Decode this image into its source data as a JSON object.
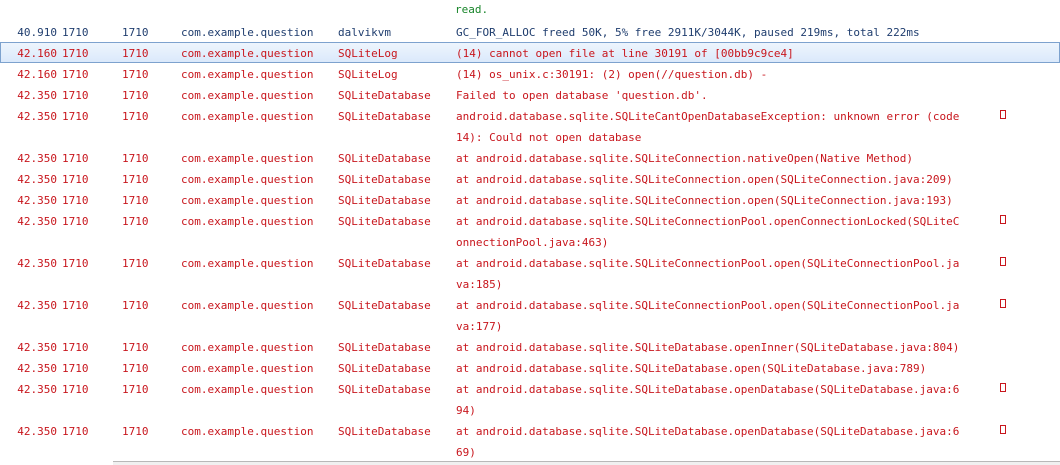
{
  "log": {
    "header_fragment": "read.",
    "rows": [
      {
        "time": "40.910",
        "pid": "1710",
        "tid": "1710",
        "app": "com.example.question",
        "tag": "dalvikvm",
        "text": "GC_FOR_ALLOC freed 50K, 5% free 2911K/3044K, paused 219ms, total 222ms",
        "text2": "",
        "level": "debug",
        "selected": false
      },
      {
        "time": "42.160",
        "pid": "1710",
        "tid": "1710",
        "app": "com.example.question",
        "tag": "SQLiteLog",
        "text": "(14) cannot open file at line 30191 of [00bb9c9ce4]",
        "text2": "",
        "level": "error",
        "selected": true
      },
      {
        "time": "42.160",
        "pid": "1710",
        "tid": "1710",
        "app": "com.example.question",
        "tag": "SQLiteLog",
        "text": "(14) os_unix.c:30191: (2) open(//question.db) -",
        "text2": "",
        "level": "error",
        "selected": false
      },
      {
        "time": "42.350",
        "pid": "1710",
        "tid": "1710",
        "app": "com.example.question",
        "tag": "SQLiteDatabase",
        "text": "Failed to open database 'question.db'.",
        "text2": "",
        "level": "error",
        "selected": false
      },
      {
        "time": "42.350",
        "pid": "1710",
        "tid": "1710",
        "app": "com.example.question",
        "tag": "SQLiteDatabase",
        "text": "android.database.sqlite.SQLiteCantOpenDatabaseException: unknown error (code",
        "text2": "14): Could not open database",
        "level": "error",
        "selected": false
      },
      {
        "time": "42.350",
        "pid": "1710",
        "tid": "1710",
        "app": "com.example.question",
        "tag": "SQLiteDatabase",
        "text": "at android.database.sqlite.SQLiteConnection.nativeOpen(Native Method)",
        "text2": "",
        "level": "error",
        "selected": false
      },
      {
        "time": "42.350",
        "pid": "1710",
        "tid": "1710",
        "app": "com.example.question",
        "tag": "SQLiteDatabase",
        "text": "at android.database.sqlite.SQLiteConnection.open(SQLiteConnection.java:209)",
        "text2": "",
        "level": "error",
        "selected": false
      },
      {
        "time": "42.350",
        "pid": "1710",
        "tid": "1710",
        "app": "com.example.question",
        "tag": "SQLiteDatabase",
        "text": "at android.database.sqlite.SQLiteConnection.open(SQLiteConnection.java:193)",
        "text2": "",
        "level": "error",
        "selected": false
      },
      {
        "time": "42.350",
        "pid": "1710",
        "tid": "1710",
        "app": "com.example.question",
        "tag": "SQLiteDatabase",
        "text": "at android.database.sqlite.SQLiteConnectionPool.openConnectionLocked(SQLiteC",
        "text2": "onnectionPool.java:463)",
        "level": "error",
        "selected": false
      },
      {
        "time": "42.350",
        "pid": "1710",
        "tid": "1710",
        "app": "com.example.question",
        "tag": "SQLiteDatabase",
        "text": "at android.database.sqlite.SQLiteConnectionPool.open(SQLiteConnectionPool.ja",
        "text2": "va:185)",
        "level": "error",
        "selected": false
      },
      {
        "time": "42.350",
        "pid": "1710",
        "tid": "1710",
        "app": "com.example.question",
        "tag": "SQLiteDatabase",
        "text": "at android.database.sqlite.SQLiteConnectionPool.open(SQLiteConnectionPool.ja",
        "text2": "va:177)",
        "level": "error",
        "selected": false
      },
      {
        "time": "42.350",
        "pid": "1710",
        "tid": "1710",
        "app": "com.example.question",
        "tag": "SQLiteDatabase",
        "text": "at android.database.sqlite.SQLiteDatabase.openInner(SQLiteDatabase.java:804)",
        "text2": "",
        "level": "error",
        "selected": false
      },
      {
        "time": "42.350",
        "pid": "1710",
        "tid": "1710",
        "app": "com.example.question",
        "tag": "SQLiteDatabase",
        "text": "at android.database.sqlite.SQLiteDatabase.open(SQLiteDatabase.java:789)",
        "text2": "",
        "level": "error",
        "selected": false
      },
      {
        "time": "42.350",
        "pid": "1710",
        "tid": "1710",
        "app": "com.example.question",
        "tag": "SQLiteDatabase",
        "text": "at android.database.sqlite.SQLiteDatabase.openDatabase(SQLiteDatabase.java:6",
        "text2": "94)",
        "level": "error",
        "selected": false
      },
      {
        "time": "42.350",
        "pid": "1710",
        "tid": "1710",
        "app": "com.example.question",
        "tag": "SQLiteDatabase",
        "text": "at android.database.sqlite.SQLiteDatabase.openDatabase(SQLiteDatabase.java:6",
        "text2": "69)",
        "level": "error",
        "selected": false
      }
    ]
  },
  "colors": {
    "debug": "#1f3d6e",
    "error": "#c8161d",
    "info": "#18852a",
    "selection": "#dbe9fb",
    "selection_border": "#7da2ce"
  },
  "icons": {
    "wrap_marker": "wrap-continuation-icon"
  }
}
